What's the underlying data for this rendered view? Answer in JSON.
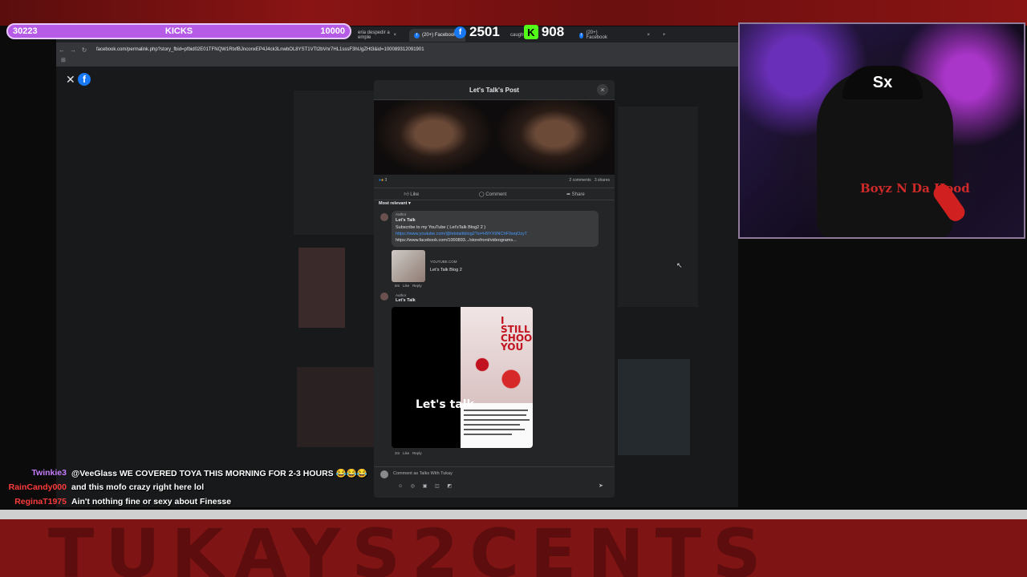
{
  "overlay": {
    "goal_bar": {
      "current": "30223",
      "label": "KICKS",
      "target": "10000",
      "color": "#b55be6"
    },
    "followers": {
      "facebook_count": "2501",
      "kick_count": "908",
      "kick_glyph": "K",
      "facebook_glyph": "f"
    },
    "banner_text": "TUKAYS2CENTS"
  },
  "browser": {
    "tabs": [
      {
        "label": "eria despedir a emple",
        "active": false
      },
      {
        "label": "(20+) Facebook",
        "active": true
      },
      {
        "label": "caught in",
        "active": false
      },
      {
        "label": "(20+) Facebook",
        "active": false
      }
    ],
    "tab_close": "×",
    "new_tab": "+",
    "url": "facebook.com/permalink.php?story_fbid=pfbid02E01TFNQW1RtxfBJnconxEP4J4ck3LnwbOL8YST1VTt2bVnr7HL1sssF3hUgZHt3&id=100089312091901",
    "nav": {
      "back": "←",
      "forward": "→",
      "reload": "↻"
    },
    "apps_icon": "⊞"
  },
  "facebook": {
    "viewer_close": "✕",
    "logo_glyph": "f",
    "modal": {
      "title": "Let's Talk's Post",
      "close": "×",
      "reactions_count": "3",
      "comments_count": "2 comments",
      "shares_count": "3 shares",
      "actions": {
        "like": "Like",
        "comment": "Comment",
        "share": "Share"
      },
      "sort_label": "Most relevant",
      "comments": [
        {
          "tag": "Author",
          "author": "Let's Talk",
          "text": "Subscribe to my YouTube ( Let'sTalk Blog2 2 )",
          "link1": "https://www.youtube.com/@letstalkblog2?si=H9YX9NChF0wqOzy7",
          "link2": "https://www.facebook.com/1000893.../storefront/videograms...",
          "preview_domain": "YOUTUBE.COM",
          "preview_title": "Let's Talk Blog 2",
          "time": "6m",
          "like": "Like",
          "reply": "Reply"
        },
        {
          "tag": "Author",
          "author": "Let's Talk",
          "media_overlay_text": "Let's talk",
          "media_photo_text": "I STILL CHOOSE YOU",
          "time": "2m",
          "like": "Like",
          "reply": "Reply"
        }
      ],
      "composer_placeholder": "Comment as Talks With Tukay",
      "composer_icons": "☺ ◎ ▣ ◫ ◩",
      "send_icon": "➤"
    }
  },
  "chat": [
    {
      "user": "Twinkie3",
      "color": "#c77dff",
      "message": "@VeeGlass WE COVERED TOYA THIS MORNING FOR 2-3 HOURS 😂😂😂"
    },
    {
      "user": "RainCandy000",
      "color": "#ff3b3b",
      "message": "and this mofo crazy right here lol"
    },
    {
      "user": "ReginaT1975",
      "color": "#ff3b3b",
      "message": "Ain't nothing fine or sexy about Finesse"
    }
  ],
  "webcam": {
    "cap_logo": "Sx",
    "hoodie_text": "Boyz N Da Hood"
  }
}
